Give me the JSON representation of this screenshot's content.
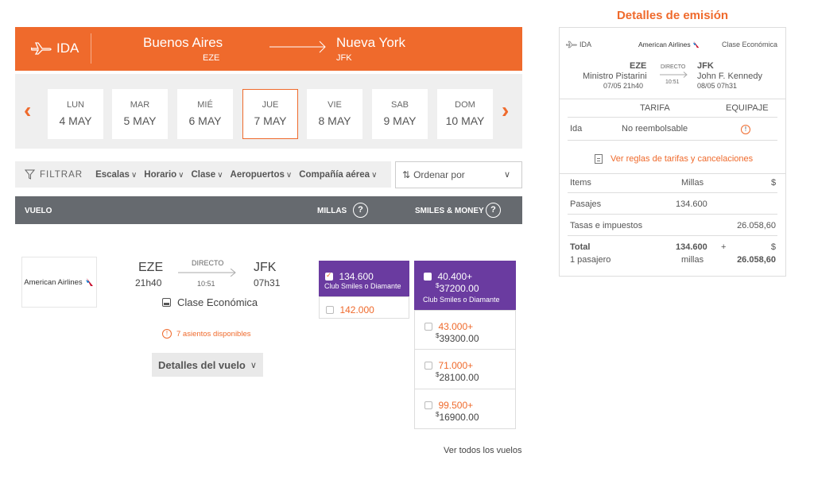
{
  "route": {
    "direction_label": "IDA",
    "origin_city": "Buenos Aires",
    "origin_code": "EZE",
    "dest_city": "Nueva York",
    "dest_code": "JFK"
  },
  "dates": [
    {
      "dow": "LUN",
      "date": "4 MAY",
      "selected": false
    },
    {
      "dow": "MAR",
      "date": "5 MAY",
      "selected": false
    },
    {
      "dow": "MIÉ",
      "date": "6 MAY",
      "selected": false
    },
    {
      "dow": "JUE",
      "date": "7 MAY",
      "selected": true
    },
    {
      "dow": "VIE",
      "date": "8 MAY",
      "selected": false
    },
    {
      "dow": "SAB",
      "date": "9 MAY",
      "selected": false
    },
    {
      "dow": "DOM",
      "date": "10 MAY",
      "selected": false
    }
  ],
  "filters": {
    "label": "FILTRAR",
    "options": [
      "Escalas",
      "Horario",
      "Clase",
      "Aeropuertos",
      "Compañía aérea"
    ],
    "sort_label": "Ordenar por"
  },
  "columns": {
    "flight": "VUELO",
    "miles": "MILLAS",
    "smiles_money": "SMILES & MONEY",
    "help": "?"
  },
  "flight": {
    "airline": "American Airlines",
    "dep_code": "EZE",
    "dep_time": "21h40",
    "stops": "DIRECTO",
    "duration": "10:51",
    "arr_code": "JFK",
    "arr_time": "07h31",
    "cabin": "Clase Económica",
    "seats": "7 asientos disponibles",
    "details_button": "Detalles del vuelo"
  },
  "miles_options": {
    "selected": {
      "value": "134.600",
      "tier": "Club Smiles o Diamante"
    },
    "other": {
      "value": "142.000"
    }
  },
  "money_options": {
    "selected": {
      "miles": "40.400+",
      "currency": "$",
      "money": "37200.00",
      "tier": "Club Smiles o Diamante"
    },
    "others": [
      {
        "miles": "43.000+",
        "currency": "$",
        "money": "39300.00"
      },
      {
        "miles": "71.000+",
        "currency": "$",
        "money": "28100.00"
      },
      {
        "miles": "99.500+",
        "currency": "$",
        "money": "16900.00"
      }
    ]
  },
  "see_all": "Ver todos los vuelos",
  "panel": {
    "title": "Detalles de emisión",
    "direction": "IDA",
    "airline": "American Airlines",
    "cabin": "Clase Económica",
    "dep_code": "EZE",
    "dep_airport": "Ministro Pistarini",
    "dep_datetime": "07/05 21h40",
    "stops": "DIRECTO",
    "duration": "10:51",
    "arr_code": "JFK",
    "arr_airport": "John F. Kennedy",
    "arr_datetime": "08/05 07h31",
    "fare_header": "TARIFA",
    "baggage_header": "EQUIPAJE",
    "leg": "Ida",
    "fare_value": "No reembolsable",
    "baggage_icon_text": "!",
    "rules_link": "Ver reglas de tarifas y cancelaciones",
    "items_header": "Items",
    "miles_header": "Millas",
    "money_header": "$",
    "rows": [
      {
        "label": "Pasajes",
        "miles": "134.600",
        "money": ""
      },
      {
        "label": "Tasas e impuestos",
        "miles": "",
        "money": "26.058,60"
      }
    ],
    "total_label": "Total",
    "passengers": "1 pasajero",
    "total_miles": "134.600",
    "plus": "+",
    "total_currency": "$",
    "miles_unit": "millas",
    "total_money": "26.058,60"
  },
  "colors": {
    "accent": "#ef6a2c",
    "purple": "#6a3ba0",
    "header_gray": "#666a6f",
    "strip_gray": "#efefef"
  }
}
